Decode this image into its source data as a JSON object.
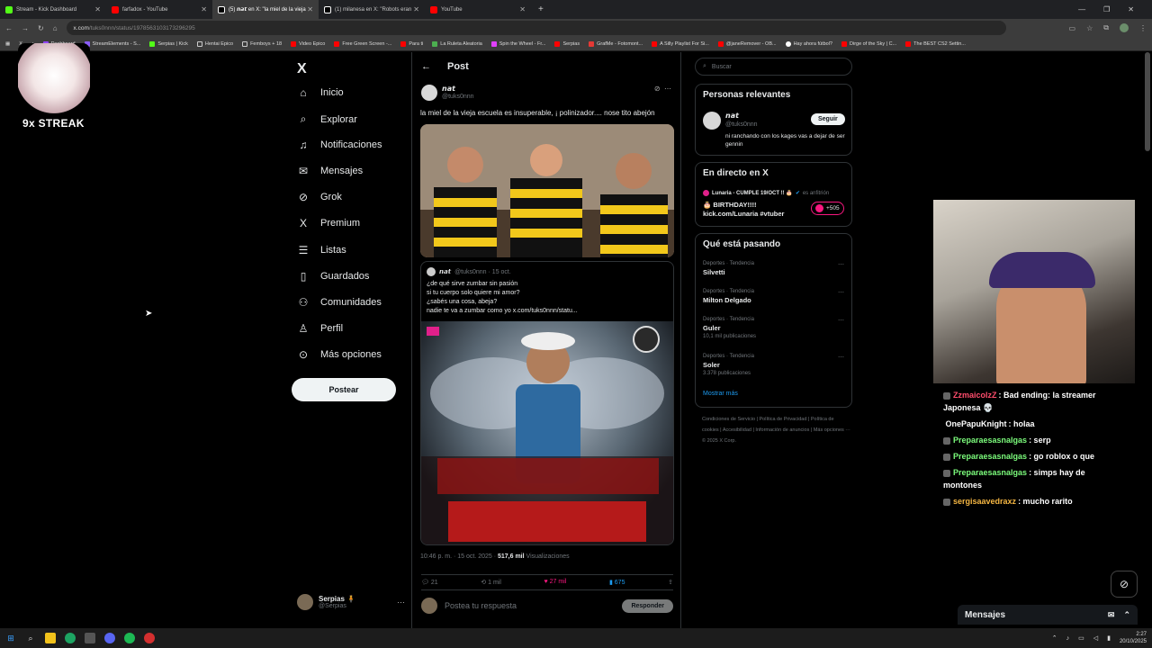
{
  "browser": {
    "tabs": [
      {
        "title": "Stream - Kick Dashboard",
        "color": "#53fc18"
      },
      {
        "title": "farfadox - YouTube",
        "color": "#ff0000"
      },
      {
        "title": "(5) 𝙣𝙖𝙩 en X: \"la miel de la vieja",
        "color": "#ffffff",
        "active": true
      },
      {
        "title": "(1) milanesa en X: \"Robots eran",
        "color": "#ffffff"
      },
      {
        "title": "YouTube",
        "color": "#ff0000"
      }
    ],
    "url_host": "x.com",
    "url_path": "/tuks0nnn/status/1978563103173296295",
    "bookmarks": [
      "Dashboard",
      "StreamElements - S...",
      "Serpias | Kick",
      "Hentai Epico",
      "Femboys + 18",
      "Video Epico",
      "Free Green Screen -...",
      "Para ti",
      "La Ruleta Aleatoria",
      "Spin the Wheel - Fr...",
      "Serpias",
      "GrafMe - Fotomont...",
      "A Silly Playlist For Si...",
      "@janeRemover - OB...",
      "Hay ahora fútbol?",
      "Dirge of the Sky | C...",
      "The BEST CS2 Settin..."
    ]
  },
  "nav": {
    "logo": "X",
    "items": [
      {
        "label": "Inicio",
        "icon": "home-icon",
        "glyph": "⌂"
      },
      {
        "label": "Explorar",
        "icon": "search-icon",
        "glyph": "⌕"
      },
      {
        "label": "Notificaciones",
        "icon": "bell-icon",
        "glyph": "🔔"
      },
      {
        "label": "Mensajes",
        "icon": "mail-icon",
        "glyph": "✉"
      },
      {
        "label": "Grok",
        "icon": "grok-icon",
        "glyph": "⊘"
      },
      {
        "label": "Premium",
        "icon": "x-icon",
        "glyph": "X"
      },
      {
        "label": "Listas",
        "icon": "list-icon",
        "glyph": "☰"
      },
      {
        "label": "Guardados",
        "icon": "bookmark-icon",
        "glyph": "🔖"
      },
      {
        "label": "Comunidades",
        "icon": "people-icon",
        "glyph": "👥"
      },
      {
        "label": "Perfil",
        "icon": "person-icon",
        "glyph": "👤"
      },
      {
        "label": "Más opciones",
        "icon": "more-icon",
        "glyph": "⋯"
      }
    ],
    "post_button": "Postear",
    "account_name": "Serpias 🧍",
    "account_handle": "@Serpias"
  },
  "post": {
    "header": "Post",
    "author": "𝙣𝙖𝙩",
    "handle": "@tuks0nnn",
    "text": "la miel de la vieja escuela es insuperable, ¡ polinizador.... nose tito abejón",
    "quote_author": "𝙣𝙖𝙩",
    "quote_meta": "@tuks0nnn · 15 oct.",
    "quote_lines": [
      "¿de qué sirve zumbar sin pasión",
      "si tu cuerpo solo quiere mi amor?",
      "¿sabés una cosa, abeja?",
      "nadie te va a zumbar como yo  x.com/tuks0nnn/statu..."
    ],
    "time": "10:46 p. m. · 15 oct. 2025 · ",
    "views": "517,6 mil",
    "views_label": " Visualizaciones",
    "replies": "21",
    "reposts": "1 mil",
    "likes": "27 mil",
    "bookmarks": "675",
    "reply_placeholder": "Postea tu respuesta",
    "reply_button": "Responder"
  },
  "right": {
    "search_placeholder": "Buscar",
    "relevant_title": "Personas relevantes",
    "relevant_name": "𝙣𝙖𝙩",
    "relevant_handle": "@tuks0nnn",
    "relevant_bio": "ni ranchando con los kages vas a dejar de ser gennin",
    "follow": "Seguir",
    "live_title": "En directo en X",
    "live_host": "Lunaria - CUMPLE 19/OCT !! 🎂",
    "live_role": "es anfitrión",
    "live_text": "🎂 BIRTHDAY!!!!",
    "live_link": "kick.com/Lunaria  #vtuber",
    "live_count": "+505",
    "trends_title": "Qué está pasando",
    "trends": [
      {
        "cat": "Deportes · Tendencia",
        "name": "Silvetti",
        "count": ""
      },
      {
        "cat": "Deportes · Tendencia",
        "name": "Milton Delgado",
        "count": ""
      },
      {
        "cat": "Deportes · Tendencia",
        "name": "Guler",
        "count": "10,1 mil publicaciones"
      },
      {
        "cat": "Deportes · Tendencia",
        "name": "Soler",
        "count": "3.378 publicaciones"
      }
    ],
    "show_more": "Mostrar más",
    "footer": "Condiciones de Servicio  |  Política de Privacidad  |  Política de cookies  |  Accesibilidad  |  Información de anuncios  |  Más opciones ···  © 2025 X Corp."
  },
  "overlay": {
    "streak": "9x STREAK",
    "chat": [
      {
        "user": "ZzmaicolzZ",
        "color": "#ff4d6d",
        "msg": ": Bad ending: la streamer Japonesa 💀"
      },
      {
        "user": "OnePapuKnight",
        "color": "#ffffff",
        "msg": ": holaa"
      },
      {
        "user": "Preparaesasnalgas",
        "color": "#7cfc7c",
        "msg": ": serp"
      },
      {
        "user": "Preparaesasnalgas",
        "color": "#7cfc7c",
        "msg": ": go roblox o que"
      },
      {
        "user": "Preparaesasnalgas",
        "color": "#7cfc7c",
        "msg": ": simps hay de montones"
      },
      {
        "user": "sergisaavedraxz",
        "color": "#f5b642",
        "msg": ": mucho rarito"
      }
    ],
    "messages_bar": "Mensajes"
  },
  "taskbar": {
    "time": "2:27",
    "date": "20/10/2025"
  }
}
